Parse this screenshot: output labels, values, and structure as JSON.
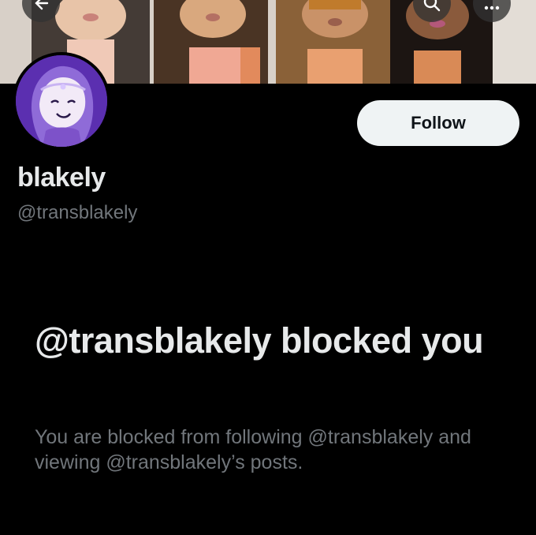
{
  "banner": {
    "description_icon": "banner-image"
  },
  "top_bar": {
    "back_icon": "back-arrow-icon",
    "search_icon": "search-icon",
    "more_icon": "more-icon"
  },
  "profile": {
    "display_name": "blakely",
    "handle": "@transblakely",
    "follow_label": "Follow"
  },
  "blocked_notice": {
    "title": "@transblakely blocked you",
    "description": "You are blocked from following @transblakely and viewing @transblakely’s posts."
  },
  "colors": {
    "background": "#000000",
    "primary_text": "#e7e9ea",
    "secondary_text": "#71767b",
    "follow_button_bg": "#eff3f4",
    "follow_button_text": "#0f1419",
    "avatar_bg": "#5b2fb0"
  }
}
